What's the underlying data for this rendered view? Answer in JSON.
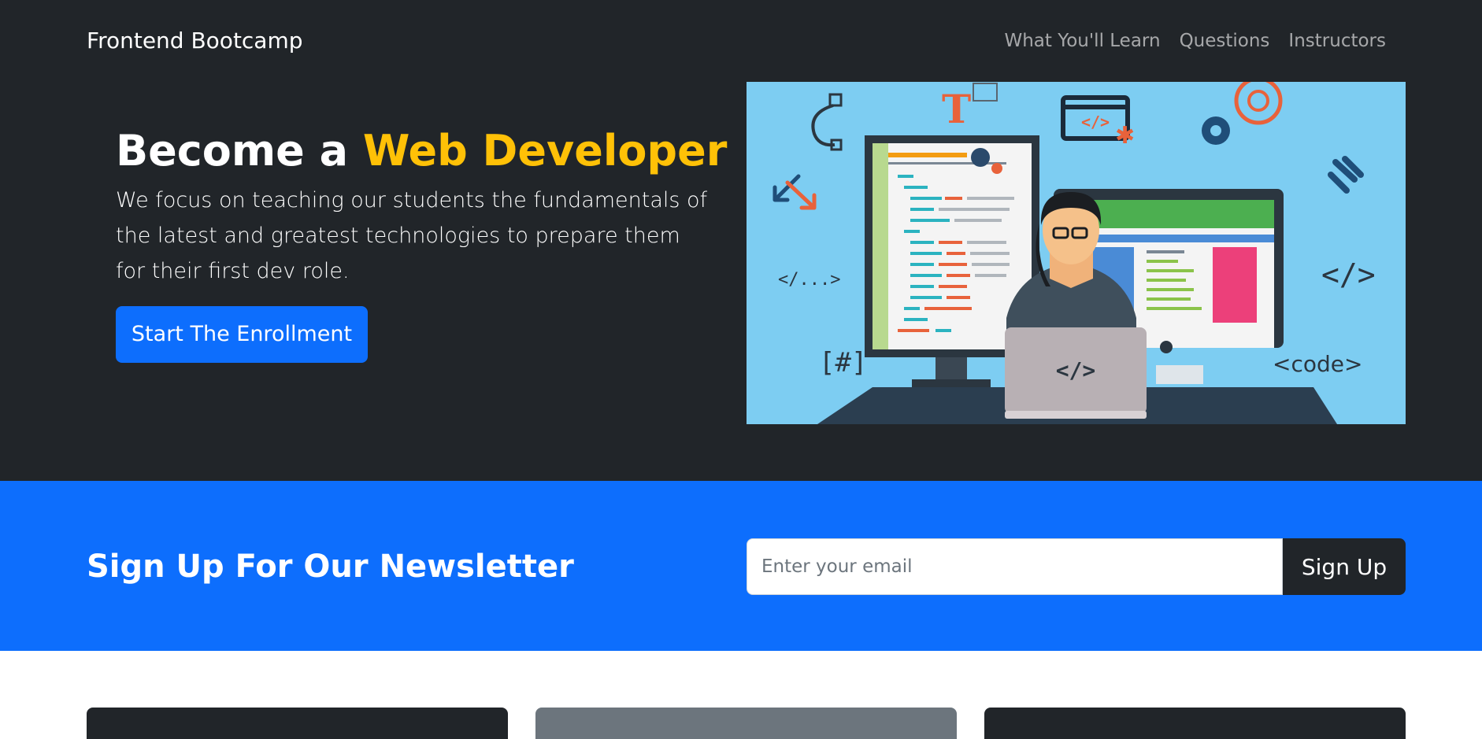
{
  "navbar": {
    "brand": "Frontend Bootcamp",
    "links": [
      {
        "label": "What You'll Learn"
      },
      {
        "label": "Questions"
      },
      {
        "label": "Instructors"
      }
    ]
  },
  "hero": {
    "title_prefix": "Become a ",
    "title_accent": "Web Developer",
    "lead": "We focus on teaching our students the fundamentals of the latest and greatest technologies to prepare them for their first dev role.",
    "cta_label": "Start The Enrollment",
    "illustration": {
      "labels": {
        "t": "T",
        "code_tag": "</>",
        "code_ellipsis": "</...>",
        "hash": "[#]",
        "code_word": "<code>",
        "laptop_code": "</>",
        "window_code": "</>"
      }
    }
  },
  "newsletter": {
    "title": "Sign Up For Our Newsletter",
    "email_placeholder": "Enter your email",
    "email_value": "",
    "button_label": "Sign Up"
  },
  "colors": {
    "dark": "#212529",
    "primary": "#0d6efd",
    "warning": "#ffc107",
    "secondary": "#6c757d"
  }
}
